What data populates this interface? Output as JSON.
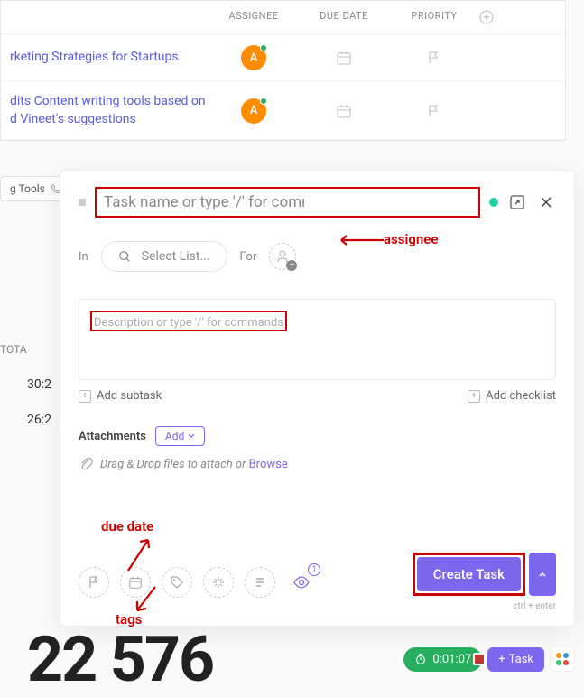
{
  "table": {
    "columns": {
      "assignee": "ASSIGNEE",
      "due_date": "DUE DATE",
      "priority": "PRIORITY"
    },
    "rows": [
      {
        "name": "rketing Strategies for Startups",
        "avatar": "A"
      },
      {
        "name": "dits Content writing tools based on d Vineet's suggestions",
        "avatar": "A"
      }
    ]
  },
  "tools_chip": "g Tools",
  "totals_label": "TOTA",
  "time_a": "30:2",
  "time_b": "26:2",
  "big_number": "22  576",
  "modal": {
    "task_name_placeholder": "Task name or type '/' for commands",
    "in_label": "In",
    "select_list_placeholder": "Select List...",
    "for_label": "For",
    "description_placeholder": "Description or type '/' for commands",
    "add_subtask": "Add subtask",
    "add_checklist": "Add checklist",
    "attachments_label": "Attachments",
    "add_button": "Add",
    "drag_text": "Drag & Drop files to attach or ",
    "browse": "Browse",
    "watcher_count": "1",
    "create_button": "Create Task",
    "ctrl_hint": "ctrl + enter"
  },
  "annotations": {
    "assignee": "assignee",
    "due_date": "due date",
    "tags": "tags"
  },
  "bottom_bar": {
    "timer": "0:01:07",
    "task_button": "Task"
  }
}
